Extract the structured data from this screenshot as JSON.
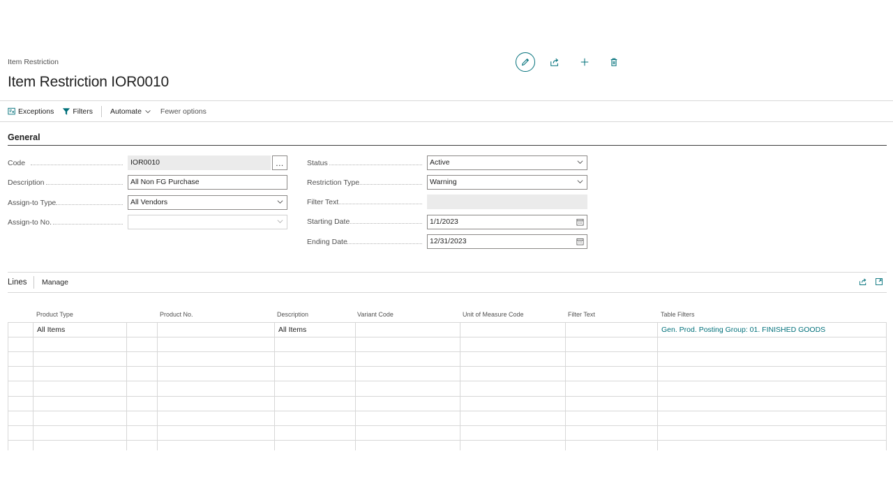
{
  "breadcrumb": "Item Restriction",
  "title": "Item Restriction IOR0010",
  "header_actions": {
    "edit_icon": "pencil-icon",
    "share_icon": "share-icon",
    "add_icon": "plus-icon",
    "delete_icon": "trash-icon"
  },
  "actionbar": {
    "exceptions": "Exceptions",
    "filters": "Filters",
    "automate": "Automate",
    "fewer_options": "Fewer options"
  },
  "general": {
    "title": "General",
    "code": {
      "label": "Code",
      "value": "IOR0010",
      "assist": "..."
    },
    "description": {
      "label": "Description",
      "value": "All Non FG Purchase"
    },
    "assign_to_type": {
      "label": "Assign-to Type",
      "value": "All Vendors"
    },
    "assign_to_no": {
      "label": "Assign-to No.",
      "value": ""
    },
    "status": {
      "label": "Status",
      "value": "Active"
    },
    "restriction_type": {
      "label": "Restriction Type",
      "value": "Warning"
    },
    "filter_text": {
      "label": "Filter Text",
      "value": ""
    },
    "starting_date": {
      "label": "Starting Date",
      "value": "1/1/2023"
    },
    "ending_date": {
      "label": "Ending Date",
      "value": "12/31/2023"
    }
  },
  "lines": {
    "title": "Lines",
    "manage": "Manage",
    "columns": {
      "product_type": "Product Type",
      "product_no": "Product No.",
      "description": "Description",
      "variant_code": "Variant Code",
      "uom_code": "Unit of Measure Code",
      "filter_text": "Filter Text",
      "table_filters": "Table Filters"
    },
    "rows": [
      {
        "product_type": "All Items",
        "product_no": "",
        "description": "All Items",
        "variant_code": "",
        "uom_code": "",
        "filter_text": "",
        "table_filters": "Gen. Prod. Posting Group: 01. FINISHED GOODS"
      }
    ]
  },
  "colors": {
    "accent": "#00707a",
    "border": "#8a8886",
    "readonly_bg": "#ebebeb"
  }
}
